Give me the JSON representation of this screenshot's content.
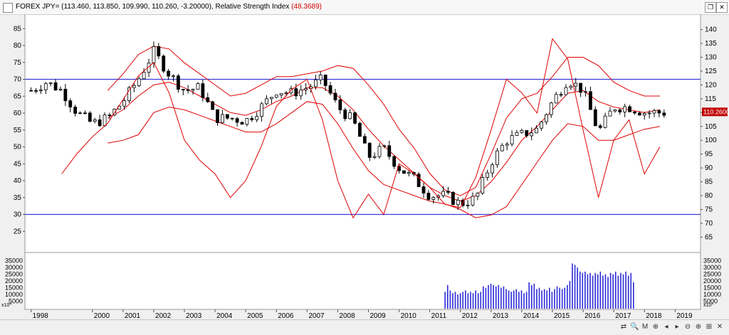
{
  "window": {
    "title_prefix": "FOREX JPY= (113.460, 113.850, 109.990, 110.260, -3.20000), Relative Strength Index ",
    "title_rsi": "(48.3689)",
    "restore_label": "❐",
    "close_label": "✕"
  },
  "colors": {
    "candle": "#000000",
    "band": "#e00000",
    "rsi": "#e00000",
    "level_lines": "#3b3bd6",
    "volume": "#2a2ad8",
    "last_price_bg": "#c00000"
  },
  "statusbar": {
    "buttons": [
      "⇄",
      "🔍",
      "M",
      "⊕",
      "◂",
      "▸",
      "⊖",
      "⊕",
      "⊞",
      "✕"
    ]
  },
  "chart_data": [
    {
      "type": "candlestick",
      "title": "FOREX JPY=",
      "subtitle": "(113.460, 113.850, 109.990, 110.260, -3.20000)",
      "x_ticks": [
        "1998",
        "2000",
        "2001",
        "2002",
        "2003",
        "2004",
        "2005",
        "2006",
        "2007",
        "2008",
        "2009",
        "2010",
        "2011",
        "2012",
        "2013",
        "2014",
        "2015",
        "2016",
        "2017",
        "2018",
        "2019"
      ],
      "y_right_ticks": [
        65,
        70,
        75,
        80,
        85,
        90,
        95,
        100,
        105,
        110,
        115,
        120,
        125,
        130,
        135,
        140
      ],
      "y_right_range": [
        61,
        144
      ],
      "last_price_label": "110.2600",
      "series": [
        {
          "name": "Price close (approx.)",
          "x": [
            "1998",
            "1998.5",
            "1999",
            "1999.5",
            "2000",
            "2000.5",
            "2001",
            "2001.5",
            "2002",
            "2002.5",
            "2003",
            "2003.5",
            "2004",
            "2004.5",
            "2005",
            "2005.5",
            "2006",
            "2006.5",
            "2007",
            "2007.5",
            "2008",
            "2008.5",
            "2009",
            "2009.5",
            "2010",
            "2010.5",
            "2011",
            "2011.5",
            "2012",
            "2012.5",
            "2013",
            "2013.5",
            "2014",
            "2014.5",
            "2015",
            "2015.5",
            "2016",
            "2016.5",
            "2017",
            "2017.5",
            "2018",
            "2018.5"
          ],
          "values": [
            118,
            121,
            118,
            110,
            106,
            108,
            114,
            122,
            132,
            124,
            118,
            119,
            108,
            108,
            107,
            112,
            118,
            117,
            119,
            122,
            112,
            107,
            94,
            97,
            90,
            86,
            80,
            80,
            77,
            79,
            92,
            100,
            102,
            104,
            114,
            122,
            118,
            103,
            112,
            112,
            110,
            110
          ]
        },
        {
          "name": "Bollinger upper (approx.)",
          "x": [
            "2000.5",
            "2001",
            "2001.5",
            "2002",
            "2002.5",
            "2003",
            "2003.5",
            "2004",
            "2004.5",
            "2005",
            "2005.5",
            "2006",
            "2006.5",
            "2007",
            "2007.5",
            "2008",
            "2008.5",
            "2009",
            "2009.5",
            "2010",
            "2010.5",
            "2011",
            "2011.5",
            "2012",
            "2012.5",
            "2013",
            "2013.5",
            "2014",
            "2014.5",
            "2015",
            "2015.5",
            "2016",
            "2016.5",
            "2017",
            "2017.5",
            "2018",
            "2018.5"
          ],
          "values": [
            118,
            124,
            131,
            134,
            133,
            128,
            124,
            120,
            116,
            117,
            120,
            123,
            123,
            124,
            125,
            127,
            126,
            120,
            113,
            104,
            97,
            88,
            82,
            80,
            83,
            95,
            108,
            115,
            117,
            123,
            130,
            130,
            127,
            121,
            118,
            116,
            116
          ]
        },
        {
          "name": "Bollinger middle (approx.)",
          "x": [
            "2000.5",
            "2001",
            "2001.5",
            "2002",
            "2002.5",
            "2003",
            "2003.5",
            "2004",
            "2004.5",
            "2005",
            "2005.5",
            "2006",
            "2006.5",
            "2007",
            "2007.5",
            "2008",
            "2008.5",
            "2009",
            "2009.5",
            "2010",
            "2010.5",
            "2011",
            "2011.5",
            "2012",
            "2012.5",
            "2013",
            "2013.5",
            "2014",
            "2014.5",
            "2015",
            "2015.5",
            "2016",
            "2016.5",
            "2017",
            "2017.5",
            "2018",
            "2018.5"
          ],
          "values": [
            108,
            111,
            116,
            120,
            121,
            119,
            116,
            113,
            110,
            109,
            111,
            114,
            116,
            119,
            119,
            116,
            111,
            104,
            98,
            93,
            88,
            83,
            80,
            78,
            80,
            85,
            92,
            100,
            105,
            111,
            117,
            118,
            114,
            112,
            111,
            110,
            111
          ]
        },
        {
          "name": "Bollinger lower (approx.)",
          "x": [
            "2000.5",
            "2001",
            "2001.5",
            "2002",
            "2002.5",
            "2003",
            "2003.5",
            "2004",
            "2004.5",
            "2005",
            "2005.5",
            "2006",
            "2006.5",
            "2007",
            "2007.5",
            "2008",
            "2008.5",
            "2009",
            "2009.5",
            "2010",
            "2010.5",
            "2011",
            "2011.5",
            "2012",
            "2012.5",
            "2013",
            "2013.5",
            "2014",
            "2014.5",
            "2015",
            "2015.5",
            "2016",
            "2016.5",
            "2017",
            "2017.5",
            "2018",
            "2018.5"
          ],
          "values": [
            99,
            100,
            102,
            110,
            112,
            111,
            109,
            107,
            105,
            103,
            103,
            106,
            110,
            114,
            113,
            106,
            97,
            89,
            84,
            82,
            80,
            78,
            77,
            75,
            72,
            73,
            76,
            84,
            92,
            100,
            106,
            105,
            100,
            100,
            102,
            104,
            105
          ]
        }
      ]
    },
    {
      "type": "line",
      "title": "Relative Strength Index",
      "latest_value": 48.3689,
      "y_left_ticks": [
        25,
        30,
        35,
        40,
        45,
        50,
        55,
        60,
        65,
        70,
        75,
        80,
        85
      ],
      "y_left_range": [
        20,
        88
      ],
      "levels": [
        70,
        30
      ],
      "x": [
        "1999",
        "1999.5",
        "2000",
        "2000.5",
        "2001",
        "2001.5",
        "2002",
        "2002.5",
        "2003",
        "2003.5",
        "2004",
        "2004.5",
        "2005",
        "2005.5",
        "2006",
        "2006.5",
        "2007",
        "2007.5",
        "2008",
        "2008.5",
        "2009",
        "2009.5",
        "2010",
        "2010.5",
        "2011",
        "2011.5",
        "2012",
        "2012.5",
        "2013",
        "2013.5",
        "2014",
        "2014.5",
        "2015",
        "2015.5",
        "2016",
        "2016.5",
        "2017",
        "2017.5",
        "2018",
        "2018.5"
      ],
      "values": [
        42,
        48,
        53,
        57,
        64,
        71,
        75,
        66,
        52,
        46,
        42,
        35,
        40,
        50,
        62,
        67,
        70,
        58,
        40,
        29,
        36,
        30,
        45,
        42,
        38,
        33,
        32,
        41,
        55,
        70,
        66,
        60,
        82,
        76,
        55,
        35,
        52,
        58,
        42,
        50
      ]
    },
    {
      "type": "bar",
      "title": "Volume",
      "y_ticks": [
        5000,
        10000,
        15000,
        20000,
        25000,
        30000,
        35000
      ],
      "y_range": [
        0,
        38000
      ],
      "axis_unit_label": "x10^",
      "x_start": "2011.5",
      "x_step_years": 0.083,
      "values": [
        12000,
        17000,
        13000,
        11000,
        12000,
        10000,
        11000,
        12000,
        13000,
        11000,
        12000,
        11000,
        13000,
        11000,
        12000,
        16000,
        15000,
        17000,
        18000,
        17000,
        16000,
        17000,
        15000,
        16000,
        14000,
        13000,
        12000,
        13000,
        14000,
        12000,
        13000,
        11000,
        12000,
        19000,
        17000,
        18000,
        14000,
        15000,
        13000,
        14000,
        13000,
        15000,
        12000,
        14000,
        16000,
        15000,
        14000,
        15000,
        17000,
        20000,
        33000,
        32000,
        30000,
        27000,
        26000,
        27000,
        25000,
        26000,
        24000,
        26000,
        25000,
        27000,
        24000,
        25000,
        23000,
        26000,
        25000,
        27000,
        24000,
        26000,
        25000,
        27000,
        24000,
        26000,
        19000
      ]
    }
  ]
}
